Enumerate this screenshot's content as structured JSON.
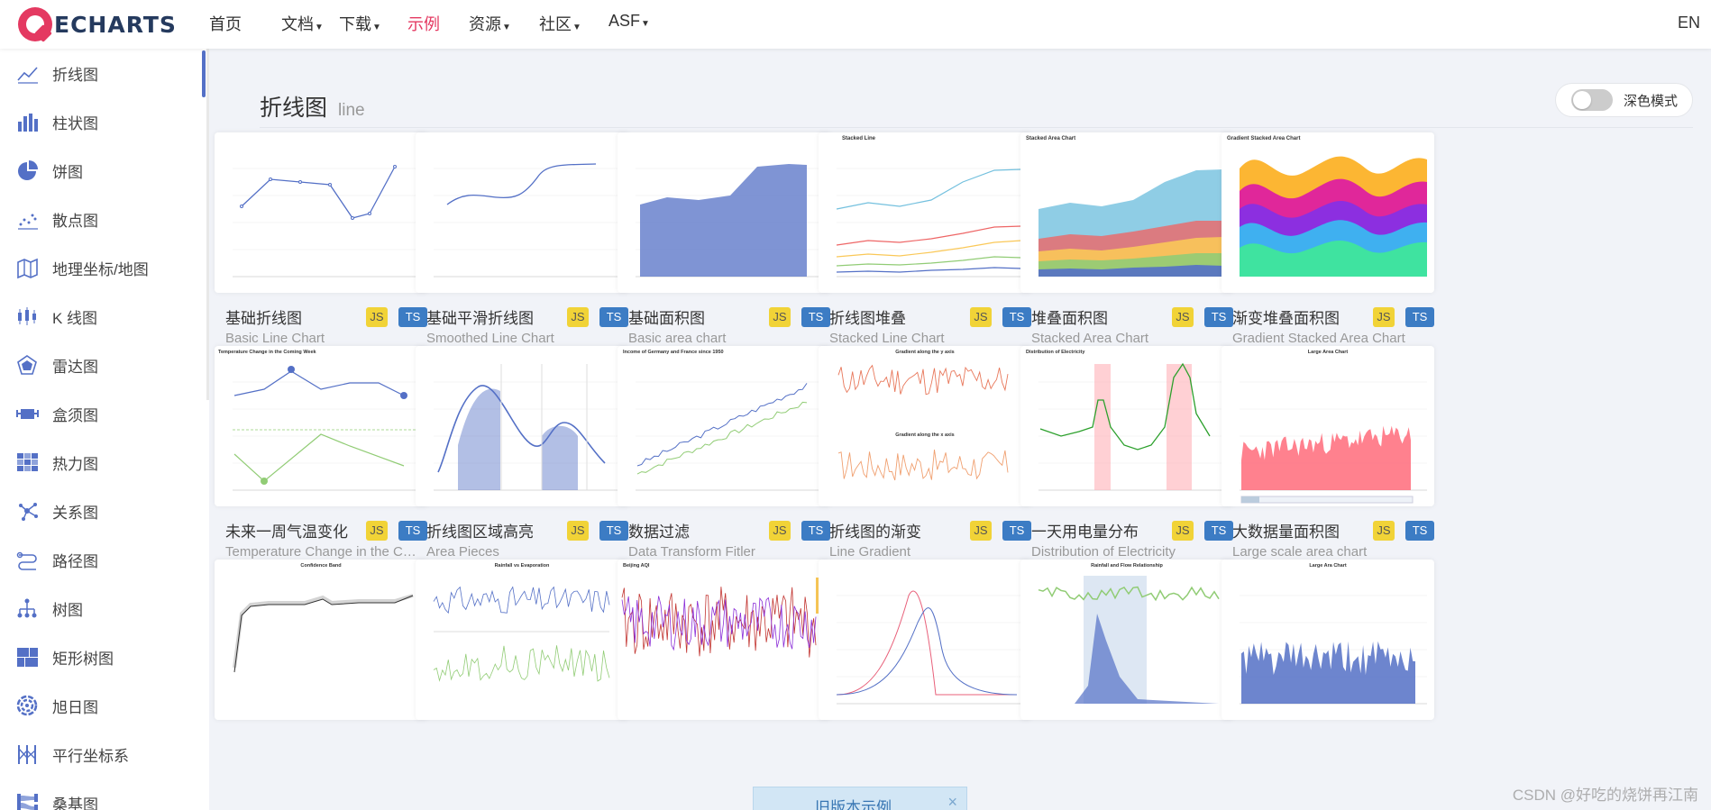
{
  "topbar": {
    "logo_text": "ECHARTS",
    "nav": [
      {
        "label": "首页",
        "dropdown": false
      },
      {
        "label": "文档",
        "dropdown": true
      },
      {
        "label": "下载",
        "dropdown": true
      },
      {
        "label": "示例",
        "dropdown": false,
        "active": true
      },
      {
        "label": "资源",
        "dropdown": true
      },
      {
        "label": "社区",
        "dropdown": true
      },
      {
        "label": "ASF",
        "dropdown": true
      }
    ],
    "lang": "EN"
  },
  "sidebar": {
    "items": [
      {
        "label": "折线图",
        "icon": "line-chart-icon"
      },
      {
        "label": "柱状图",
        "icon": "bar-chart-icon"
      },
      {
        "label": "饼图",
        "icon": "pie-chart-icon"
      },
      {
        "label": "散点图",
        "icon": "scatter-icon"
      },
      {
        "label": "地理坐标/地图",
        "icon": "map-icon"
      },
      {
        "label": "K 线图",
        "icon": "candlestick-icon"
      },
      {
        "label": "雷达图",
        "icon": "radar-icon"
      },
      {
        "label": "盒须图",
        "icon": "boxplot-icon"
      },
      {
        "label": "热力图",
        "icon": "heatmap-icon"
      },
      {
        "label": "关系图",
        "icon": "graph-icon"
      },
      {
        "label": "路径图",
        "icon": "lines-icon"
      },
      {
        "label": "树图",
        "icon": "tree-icon"
      },
      {
        "label": "矩形树图",
        "icon": "treemap-icon"
      },
      {
        "label": "旭日图",
        "icon": "sunburst-icon"
      },
      {
        "label": "平行坐标系",
        "icon": "parallel-icon"
      },
      {
        "label": "桑基图",
        "icon": "sankey-icon"
      }
    ]
  },
  "main": {
    "title": "折线图",
    "title_en": "line",
    "dark_mode_label": "深色模式",
    "cards": [
      {
        "title": "基础折线图",
        "subtitle": "Basic Line Chart",
        "thumb": "basic-line"
      },
      {
        "title": "基础平滑折线图",
        "subtitle": "Smoothed Line Chart",
        "thumb": "smooth-line"
      },
      {
        "title": "基础面积图",
        "subtitle": "Basic area chart",
        "thumb": "basic-area"
      },
      {
        "title": "折线图堆叠",
        "subtitle": "Stacked Line Chart",
        "thumb": "stacked-line"
      },
      {
        "title": "堆叠面积图",
        "subtitle": "Stacked Area Chart",
        "thumb": "stacked-area"
      },
      {
        "title": "渐变堆叠面积图",
        "subtitle": "Gradient Stacked Area Chart",
        "thumb": "gradient-stacked"
      },
      {
        "title": "未来一周气温变化",
        "subtitle": "Temperature Change in the Coming Week",
        "thumb": "temperature"
      },
      {
        "title": "折线图区域高亮",
        "subtitle": "Area Pieces",
        "thumb": "area-pieces"
      },
      {
        "title": "数据过滤",
        "subtitle": "Data Transform Fitler",
        "thumb": "data-filter"
      },
      {
        "title": "折线图的渐变",
        "subtitle": "Line Gradient",
        "thumb": "line-gradient"
      },
      {
        "title": "一天用电量分布",
        "subtitle": "Distribution of Electricity",
        "thumb": "electricity"
      },
      {
        "title": "大数据量面积图",
        "subtitle": "Large scale area chart",
        "thumb": "large-area"
      },
      {
        "title": "",
        "subtitle": "",
        "thumb": "confidence-band"
      },
      {
        "title": "",
        "subtitle": "",
        "thumb": "rainfall-evaporation"
      },
      {
        "title": "",
        "subtitle": "",
        "thumb": "beijing-aqi"
      },
      {
        "title": "",
        "subtitle": "",
        "thumb": "multiple-x"
      },
      {
        "title": "",
        "subtitle": "",
        "thumb": "rainfall-flow"
      },
      {
        "title": "",
        "subtitle": "",
        "thumb": "large-ara"
      }
    ],
    "badge_js": "JS",
    "badge_ts": "TS",
    "thumb_texts": {
      "stacked_line": "Stacked Line",
      "stacked_area": "Stacked Area Chart",
      "gradient_stacked": "Gradient Stacked Area Chart",
      "temperature": "Temperature Change in the Coming Week",
      "data_filter": "Income of Germany and France since 1950",
      "gradient_y": "Gradient along the y axis",
      "gradient_x": "Gradient along the x axis",
      "electricity": "Distribution of Electricity",
      "large_area": "Large Area Chart",
      "confidence": "Confidence Band",
      "rainfall": "Rainfall vs Evaporation",
      "aqi": "Beijing AQI",
      "rain_flow": "Rainfall and Flow Relationship",
      "large_ara": "Large Ara Chart"
    }
  },
  "old_version": "旧版本示例",
  "old_close": "×",
  "watermark": "CSDN @好吃的烧饼再江南"
}
